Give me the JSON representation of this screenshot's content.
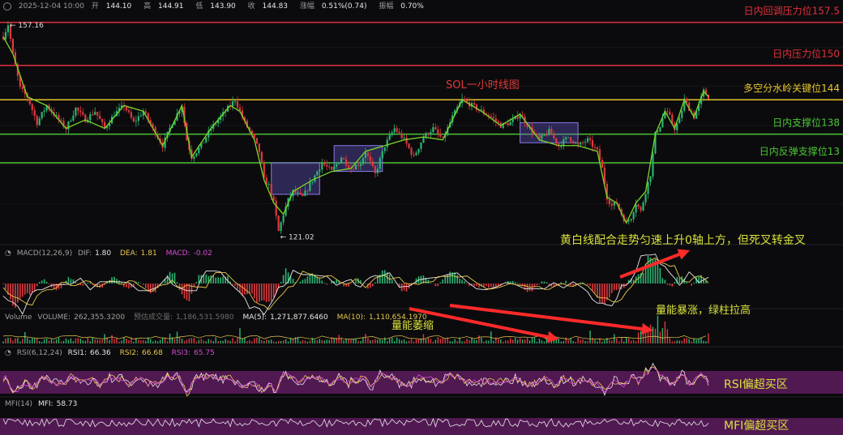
{
  "header": {
    "datetime": "2025-12-04 10:00",
    "open_label": "开",
    "open": "144.10",
    "high_label": "高",
    "high": "144.91",
    "low_label": "低",
    "low": "143.90",
    "close_label": "收",
    "close": "144.83",
    "change_label": "涨幅",
    "change": "0.51%(0.74)",
    "amp_label": "振幅",
    "amp": "0.70%"
  },
  "chart_data": {
    "type": "candlestick",
    "title": "SOL一小时线图",
    "ylim": [
      119,
      160
    ],
    "levels": [
      {
        "label": "日内回调压力位157.5",
        "value": 157.5,
        "color": "#e0303a"
      },
      {
        "label": "日内压力位150",
        "value": 150,
        "color": "#e0303a"
      },
      {
        "label": "多空分水岭关键位144",
        "value": 144,
        "color": "#e5c42e"
      },
      {
        "label": "日内支撑位138",
        "value": 138,
        "color": "#4cc437"
      },
      {
        "label": "日内反弹支撑位13",
        "value": 133,
        "color": "#4cc437"
      }
    ],
    "max_marker": {
      "label": "157.16",
      "value": 157.16
    },
    "min_marker": {
      "label": "121.02",
      "value": 121.02
    },
    "price_path": [
      [
        0,
        155
      ],
      [
        2,
        157.16
      ],
      [
        4,
        152
      ],
      [
        7,
        146
      ],
      [
        10,
        144.5
      ],
      [
        14,
        140
      ],
      [
        18,
        143
      ],
      [
        22,
        141
      ],
      [
        26,
        139
      ],
      [
        30,
        142.5
      ],
      [
        34,
        140.5
      ],
      [
        38,
        142
      ],
      [
        42,
        139
      ],
      [
        46,
        141.5
      ],
      [
        50,
        143
      ],
      [
        54,
        140
      ],
      [
        58,
        142
      ],
      [
        62,
        139
      ],
      [
        66,
        136
      ],
      [
        70,
        140
      ],
      [
        74,
        143
      ],
      [
        76,
        137
      ],
      [
        78,
        134
      ],
      [
        82,
        136
      ],
      [
        86,
        139
      ],
      [
        90,
        141
      ],
      [
        94,
        143
      ],
      [
        96,
        144
      ],
      [
        98,
        142
      ],
      [
        100,
        140
      ],
      [
        104,
        137
      ],
      [
        106,
        135
      ],
      [
        108,
        130
      ],
      [
        110,
        129
      ],
      [
        112,
        126
      ],
      [
        114,
        121.02
      ],
      [
        116,
        124
      ],
      [
        118,
        126.5
      ],
      [
        120,
        128
      ],
      [
        124,
        127
      ],
      [
        128,
        130
      ],
      [
        132,
        133
      ],
      [
        136,
        131.5
      ],
      [
        140,
        134
      ],
      [
        144,
        132
      ],
      [
        148,
        133
      ],
      [
        150,
        135
      ],
      [
        154,
        131
      ],
      [
        158,
        136
      ],
      [
        162,
        139
      ],
      [
        166,
        137
      ],
      [
        170,
        134
      ],
      [
        174,
        137.5
      ],
      [
        178,
        139
      ],
      [
        182,
        137
      ],
      [
        186,
        141
      ],
      [
        190,
        144
      ],
      [
        194,
        143
      ],
      [
        198,
        142
      ],
      [
        202,
        141
      ],
      [
        206,
        139.5
      ],
      [
        210,
        140
      ],
      [
        214,
        141.5
      ],
      [
        218,
        139
      ],
      [
        222,
        137
      ],
      [
        226,
        138.5
      ],
      [
        230,
        136
      ],
      [
        234,
        137.5
      ],
      [
        238,
        136
      ],
      [
        242,
        137
      ],
      [
        246,
        135
      ],
      [
        248,
        132
      ],
      [
        250,
        127
      ],
      [
        252,
        125.5
      ],
      [
        254,
        126
      ],
      [
        256,
        124
      ],
      [
        258,
        122.5
      ],
      [
        260,
        123.5
      ],
      [
        262,
        126
      ],
      [
        264,
        124.5
      ],
      [
        266,
        128
      ],
      [
        268,
        131
      ],
      [
        270,
        138
      ],
      [
        272,
        139.5
      ],
      [
        274,
        142
      ],
      [
        276,
        141
      ],
      [
        278,
        139
      ],
      [
        280,
        140.5
      ],
      [
        282,
        144
      ],
      [
        284,
        142.5
      ],
      [
        286,
        141
      ],
      [
        288,
        143
      ],
      [
        290,
        145.5
      ],
      [
        292,
        144.5
      ]
    ],
    "boxes": [
      {
        "x": [
          111,
          131
        ],
        "y": [
          127.5,
          133
        ]
      },
      {
        "x": [
          137,
          157
        ],
        "y": [
          131.5,
          136
        ]
      },
      {
        "x": [
          214,
          238
        ],
        "y": [
          136.5,
          140
        ]
      }
    ],
    "annotations": [
      {
        "text": "黄白线配合走势匀速上升0轴上方，但死叉转金叉",
        "color": "#d8e23a"
      },
      {
        "text": "量能萎缩",
        "color": "#d8e23a"
      },
      {
        "text": "量能暴涨，绿柱拉高",
        "color": "#d8e23a"
      },
      {
        "text": "RSI偏超买区",
        "color": "#d8e23a"
      },
      {
        "text": "MFI偏超买区",
        "color": "#d8e23a"
      }
    ]
  },
  "macd": {
    "name": "MACD(12,26,9)",
    "dif_label": "DIF:",
    "dif": "1.80",
    "dea_label": "DEA:",
    "dea": "1.81",
    "macd_label": "MACD:",
    "macd": "-0.02"
  },
  "volume": {
    "name": "Volume",
    "vol_label": "VOLUME:",
    "vol": "262,355.3200",
    "est_label": "预估成交量:",
    "est": "1,186,531.5980",
    "ma5_label": "MA(5):",
    "ma5": "1,271,877.6460",
    "ma10_label": "MA(10):",
    "ma10": "1,110,654.1970"
  },
  "rsi": {
    "name": "RSI(6,12,24)",
    "r1_label": "RSI1:",
    "r1": "66.36",
    "r2_label": "RSI2:",
    "r2": "66.68",
    "r3_label": "RSI3:",
    "r3": "65.75"
  },
  "mfi": {
    "name": "MFI(14)",
    "m_label": "MFI:",
    "m": "58.73"
  },
  "colors": {
    "bg": "#0b0b0d",
    "up": "#2bb673",
    "down": "#e0393e",
    "trend": "#7bd82a",
    "box": "#6b5bd6",
    "rsi_band": "#6a1f6a"
  }
}
